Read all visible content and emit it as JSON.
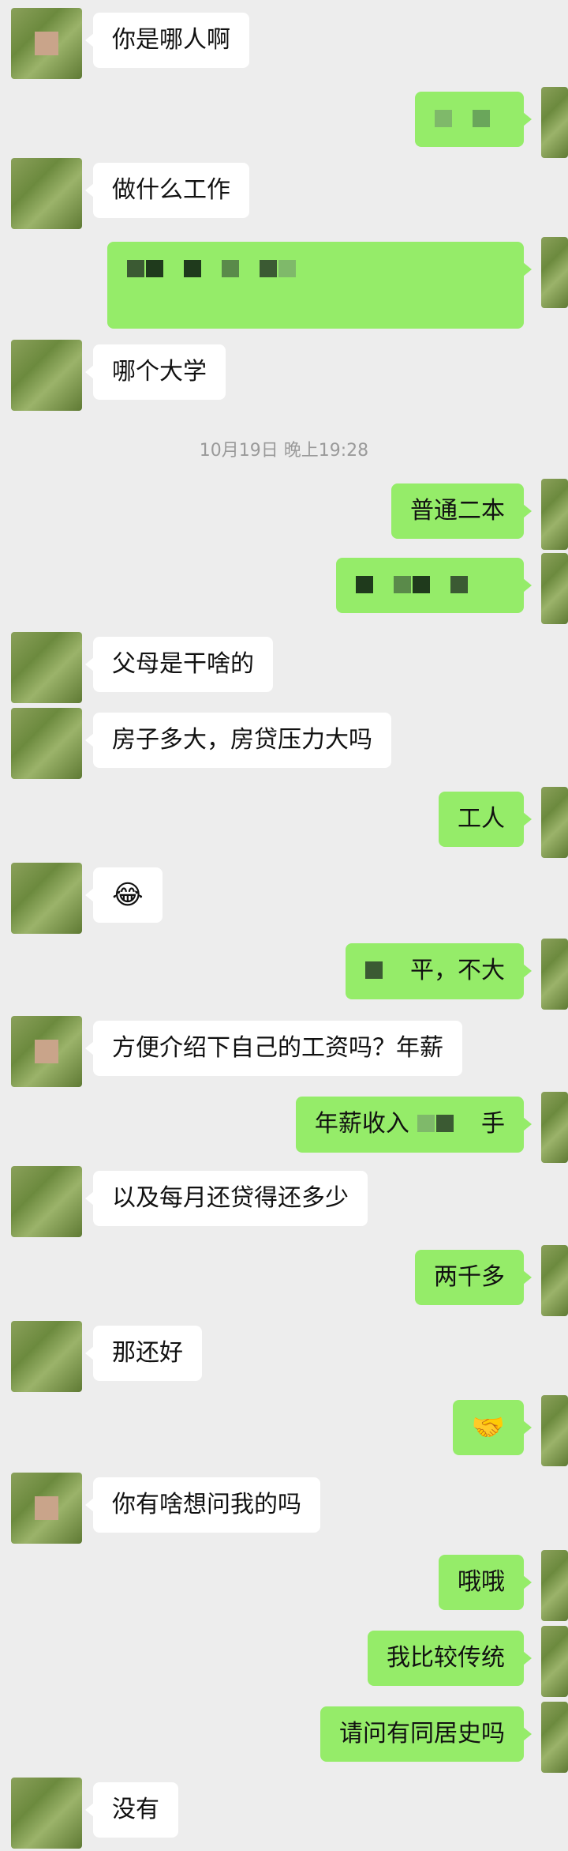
{
  "timestamp": "10月19日 晚上19:28",
  "messages": [
    {
      "side": "left",
      "text": "你是哪人啊"
    },
    {
      "side": "right",
      "text": ""
    },
    {
      "side": "left",
      "text": "做什么工作"
    },
    {
      "side": "right",
      "text": ""
    },
    {
      "side": "left",
      "text": "哪个大学"
    },
    {
      "side": "right",
      "text": "普通二本"
    },
    {
      "side": "right",
      "text": ""
    },
    {
      "side": "left",
      "text": "父母是干啥的"
    },
    {
      "side": "left",
      "text": "房子多大，房贷压力大吗"
    },
    {
      "side": "right",
      "text": "工人"
    },
    {
      "side": "left",
      "text": "😂"
    },
    {
      "side": "right",
      "text": "平，不大"
    },
    {
      "side": "left",
      "text": "方便介绍下自己的工资吗？年薪"
    },
    {
      "side": "right",
      "text": "年薪收入",
      "suffix": "手"
    },
    {
      "side": "left",
      "text": "以及每月还贷得还多少"
    },
    {
      "side": "right",
      "text": "两千多"
    },
    {
      "side": "left",
      "text": "那还好"
    },
    {
      "side": "right",
      "text": "🤝"
    },
    {
      "side": "left",
      "text": "你有啥想问我的吗"
    },
    {
      "side": "right",
      "text": "哦哦"
    },
    {
      "side": "right",
      "text": "我比较传统"
    },
    {
      "side": "right",
      "text": "请问有同居史吗"
    },
    {
      "side": "left",
      "text": "没有"
    }
  ]
}
